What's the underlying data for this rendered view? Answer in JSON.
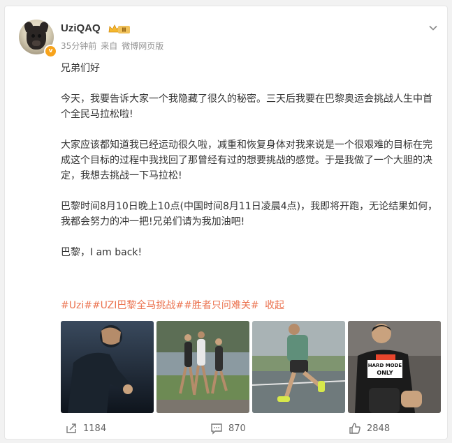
{
  "post": {
    "username": "UziQAQ",
    "badge_level": "II",
    "verified_mark": "v",
    "time": "35分钟前",
    "source_prefix": "来自",
    "source": "微博网页版",
    "paragraphs": [
      "兄弟们好",
      "今天，我要告诉大家一个我隐藏了很久的秘密。三天后我要在巴黎奥运会挑战人生中首个全民马拉松啦!",
      "大家应该都知道我已经运动很久啦，减重和恢复身体对我来说是一个很艰难的目标在完成这个目标的过程中我找回了那曾经有过的想要挑战的感觉。于是我做了一个大胆的决定，我想去挑战一下马拉松!",
      "巴黎时间8月10日晚上10点(中国时间8月11日凌晨4点)，我即将开跑，无论结果如何，我都会努力的冲一把!兄弟们请为我加油吧!",
      "巴黎，I am back!"
    ],
    "tags": [
      "#Uzi#",
      "#UZI巴黎全马挑战#",
      "#胜者只问难关#"
    ],
    "collapse_label": "收起",
    "hardmode_text_1": "HARD MODE",
    "hardmode_text_2": "ONLY"
  },
  "actions": {
    "repost_count": "1184",
    "comment_count": "870",
    "like_count": "2848"
  },
  "colors": {
    "accent": "#eb7350",
    "text": "#333333",
    "meta": "#939393",
    "badge": "#f7a31b"
  },
  "icons": [
    "chevron-down-icon",
    "share-icon",
    "comment-icon",
    "like-icon",
    "crown-badge-icon",
    "verified-icon"
  ]
}
